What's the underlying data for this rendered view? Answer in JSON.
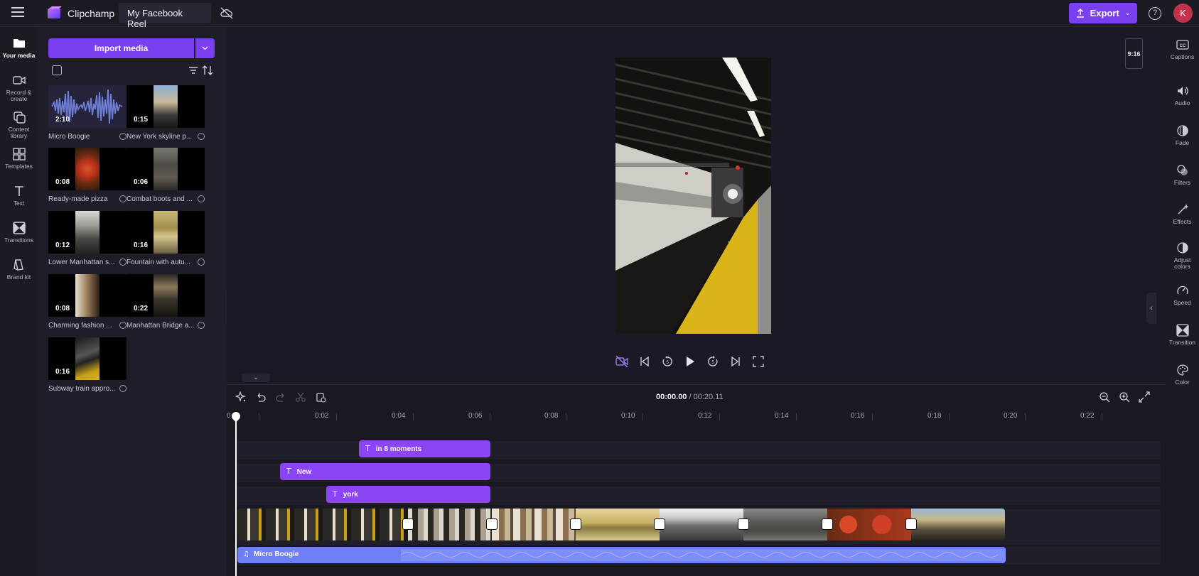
{
  "app": {
    "name": "Clipchamp",
    "project_title": "My Facebook Reel",
    "export_label": "Export",
    "avatar_initial": "K"
  },
  "left_nav": [
    {
      "label": "Your media",
      "icon": "folder-icon"
    },
    {
      "label": "Record & create",
      "icon": "camera-icon"
    },
    {
      "label": "Content library",
      "icon": "library-icon"
    },
    {
      "label": "Templates",
      "icon": "templates-icon"
    },
    {
      "label": "Text",
      "icon": "text-icon"
    },
    {
      "label": "Transitions",
      "icon": "transitions-icon"
    },
    {
      "label": "Brand kit",
      "icon": "brand-kit-icon"
    }
  ],
  "media": {
    "import_label": "Import media",
    "items": [
      {
        "duration": "2:10",
        "label": "Micro Boogie"
      },
      {
        "duration": "0:15",
        "label": "New York skyline p..."
      },
      {
        "duration": "0:08",
        "label": "Ready-made pizza"
      },
      {
        "duration": "0:06",
        "label": "Combat boots and ..."
      },
      {
        "duration": "0:12",
        "label": "Lower Manhattan s..."
      },
      {
        "duration": "0:16",
        "label": "Fountain with autu..."
      },
      {
        "duration": "0:08",
        "label": "Charming fashion ..."
      },
      {
        "duration": "0:22",
        "label": "Manhattan Bridge a..."
      },
      {
        "duration": "0:16",
        "label": "Subway train appro..."
      }
    ]
  },
  "preview": {
    "aspect_ratio": "9:16"
  },
  "right_nav": [
    {
      "label": "Captions",
      "icon": "captions-icon"
    },
    {
      "label": "Audio",
      "icon": "speaker-icon"
    },
    {
      "label": "Fade",
      "icon": "fade-icon"
    },
    {
      "label": "Filters",
      "icon": "filters-icon"
    },
    {
      "label": "Effects",
      "icon": "effects-icon"
    },
    {
      "label": "Adjust colors",
      "icon": "adjust-colors-icon"
    },
    {
      "label": "Speed",
      "icon": "speed-icon"
    },
    {
      "label": "Transition",
      "icon": "transition-icon"
    },
    {
      "label": "Color",
      "icon": "palette-icon"
    }
  ],
  "timeline": {
    "current_time": "00:00.00",
    "total_time": "/ 00:20.11",
    "ruler_ticks": [
      "0:02",
      "0:04",
      "0:06",
      "0:08",
      "0:10",
      "0:12",
      "0:14",
      "0:16",
      "0:18",
      "0:20",
      "0:22"
    ],
    "text_clips": [
      "in 8 moments",
      "New",
      "york"
    ],
    "audio_clip": "Micro Boogie"
  },
  "colors": {
    "accent": "#7b3ff2",
    "text_clip": "#8b45f5",
    "audio_clip": "#6e7ef7",
    "background": "#1b1a24"
  }
}
